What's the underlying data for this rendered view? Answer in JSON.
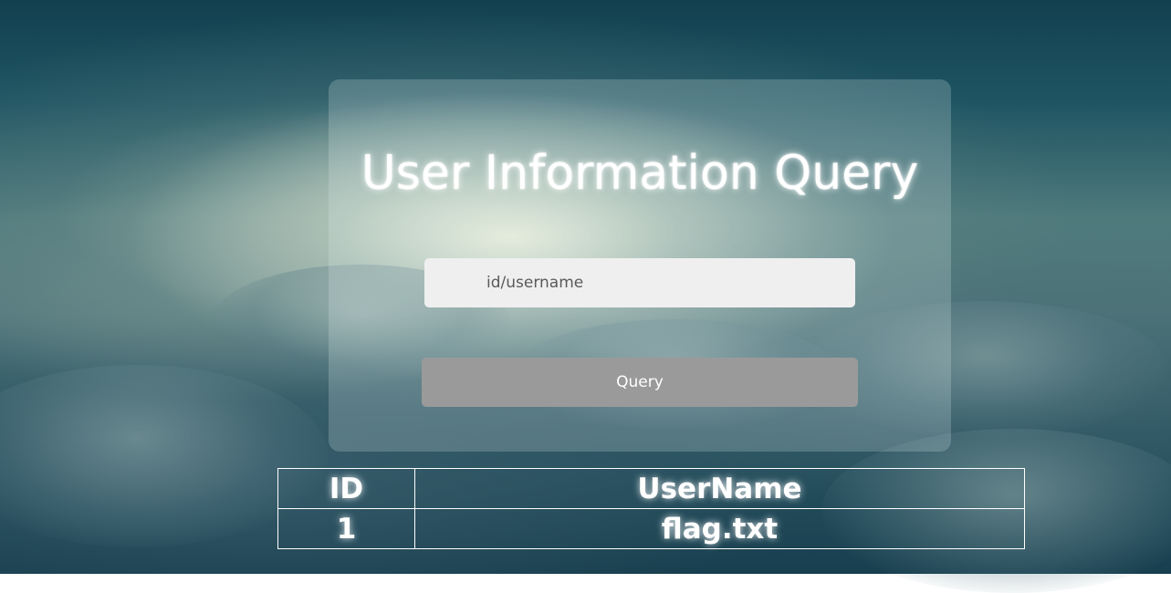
{
  "page": {
    "title": "User Information Query"
  },
  "search": {
    "placeholder": "id/username",
    "value": ""
  },
  "actions": {
    "query_label": "Query"
  },
  "results": {
    "headers": [
      "ID",
      "UserName"
    ],
    "rows": [
      [
        "1",
        "flag.txt"
      ]
    ]
  },
  "colors": {
    "input_bg": "#efefef",
    "button_bg": "#9a9a9a",
    "text": "#ffffff"
  }
}
